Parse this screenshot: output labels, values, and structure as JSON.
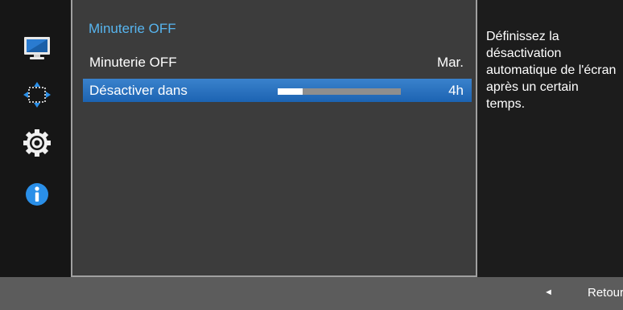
{
  "sidebar": {
    "icons": [
      "monitor-icon",
      "resize-arrows-icon",
      "gear-icon",
      "info-icon"
    ]
  },
  "panel": {
    "title": "Minuterie OFF",
    "rows": [
      {
        "label": "Minuterie OFF",
        "value": "Mar."
      },
      {
        "label": "Désactiver dans",
        "value": "4h",
        "progress": 0.2
      }
    ]
  },
  "description": "Définissez la désactivation automatique de l'écran après un certain temps.",
  "footer": {
    "back_label": "Retour",
    "back_icon": "left-triangle-icon"
  },
  "colors": {
    "title": "#57b5ef",
    "highlight": "#1c63b2",
    "panel": "#3c3c3c",
    "footer": "#5c5c5c"
  }
}
